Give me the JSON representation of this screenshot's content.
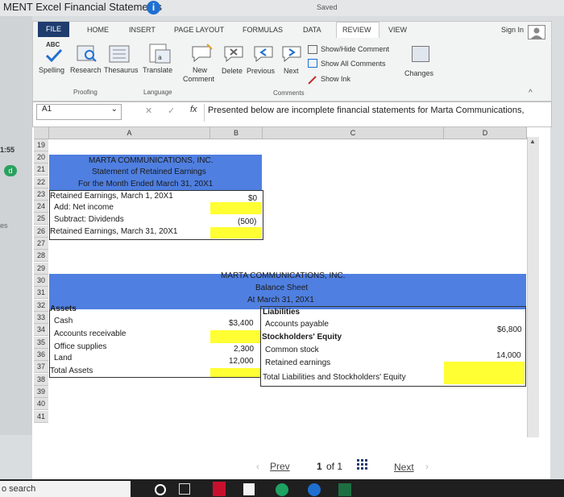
{
  "window": {
    "title": "MENT Excel Financial Statements",
    "saved": "Saved"
  },
  "left_strip": {
    "time": "1:55",
    "dot": "d",
    "note": "es"
  },
  "ribbon": {
    "tabs": [
      "FILE",
      "HOME",
      "INSERT",
      "PAGE LAYOUT",
      "FORMULAS",
      "DATA",
      "REVIEW",
      "VIEW"
    ],
    "sign_in": "Sign In",
    "buttons": {
      "spelling": "Spelling",
      "research": "Research",
      "thesaurus": "Thesaurus",
      "translate": "Translate",
      "new_comment_1": "New",
      "new_comment_2": "Comment",
      "delete": "Delete",
      "previous": "Previous",
      "next": "Next",
      "show_hide": "Show/Hide Comment",
      "show_all": "Show All Comments",
      "show_ink": "Show Ink",
      "changes": "Changes",
      "abc": "ABC"
    },
    "groups": {
      "proofing": "Proofing",
      "language": "Language",
      "comments": "Comments"
    }
  },
  "formula_bar": {
    "name_box": "A1",
    "fx": "fx",
    "content": "Presented below are incomplete financial statements for Marta Communications,"
  },
  "columns": [
    "A",
    "B",
    "C",
    "D"
  ],
  "rows": [
    "19",
    "20",
    "21",
    "22",
    "23",
    "24",
    "25",
    "26",
    "27",
    "28",
    "29",
    "30",
    "31",
    "32",
    "33",
    "34",
    "35",
    "36",
    "37",
    "38",
    "39",
    "40",
    "41"
  ],
  "retained": {
    "company": "MARTA COMMUNICATIONS, INC.",
    "statement": "Statement of Retained Earnings",
    "period": "For the Month Ended March 31, 20X1",
    "begin_label": "Retained Earnings, March 1, 20X1",
    "begin_value": "$0",
    "add_label": "Add: Net income",
    "sub_label": "Subtract: Dividends",
    "sub_value": "(500)",
    "end_label": "Retained Earnings, March 31, 20X1"
  },
  "balance": {
    "company": "MARTA COMMUNICATIONS, INC.",
    "title": "Balance Sheet",
    "date": "At March 31, 20X1",
    "assets": "Assets",
    "liabilities": "Liabilities",
    "cash": "Cash",
    "cash_value": "$3,400",
    "ap": "Accounts payable",
    "ap_value": "$6,800",
    "ar": "Accounts receivable",
    "se": "Stockholders' Equity",
    "supplies": "Office supplies",
    "supplies_value": "2,300",
    "cs": "Common stock",
    "cs_value": "14,000",
    "land": "Land",
    "land_value": "12,000",
    "re": "Retained earnings",
    "total_assets": "Total Assets",
    "total_le": "Total Liabilities and Stockholders' Equity"
  },
  "pager": {
    "prev": "Prev",
    "current": "1",
    "of": "of 1",
    "next": "Next"
  },
  "taskbar": {
    "search": "o search"
  }
}
